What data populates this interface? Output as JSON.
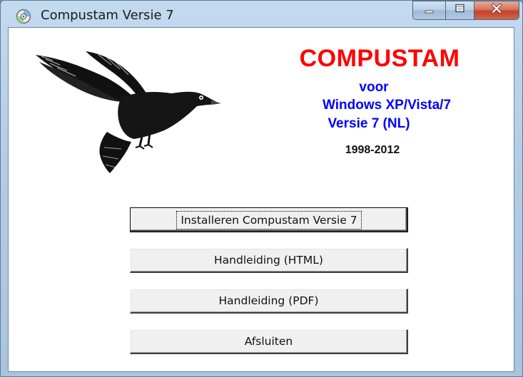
{
  "window": {
    "title": "Compustam Versie 7",
    "icon": "cd-disc-icon",
    "caption_buttons": [
      "minimize-icon",
      "maximize-icon",
      "close-icon"
    ]
  },
  "header": {
    "brand": "COMPUSTAM",
    "line_voor": "voor",
    "line_windows": "Windows XP/Vista/7",
    "line_versie": "Versie 7 (NL)",
    "years": "1998-2012",
    "logo": "dove-image"
  },
  "buttons": {
    "install": "Installeren Compustam Versie 7",
    "manual_html": "Handleiding (HTML)",
    "manual_pdf": "Handleiding (PDF)",
    "exit": "Afsluiten"
  },
  "colors": {
    "brand": "#ff0000",
    "subtitle": "#0000ff",
    "close_button": "#c4432a"
  }
}
